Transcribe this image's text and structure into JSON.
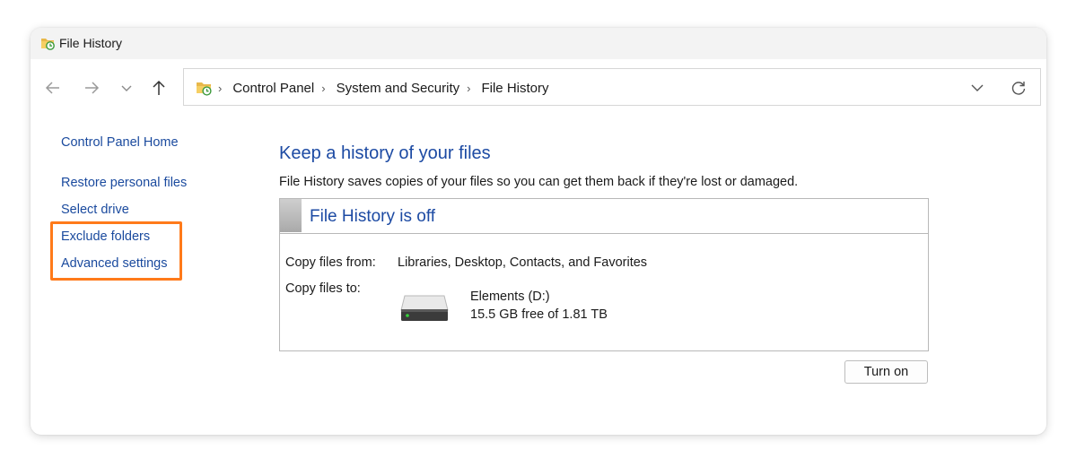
{
  "window": {
    "title": "File History"
  },
  "nav": {
    "back_icon": "arrow-left-icon",
    "forward_icon": "arrow-right-icon",
    "recent_icon": "chevron-down-icon",
    "up_icon": "arrow-up-icon"
  },
  "address": {
    "crumbs": [
      "Control Panel",
      "System and Security",
      "File History"
    ],
    "dropdown_icon": "chevron-down-icon",
    "refresh_icon": "refresh-icon"
  },
  "sidebar": {
    "items": [
      {
        "label": "Control Panel Home"
      },
      {
        "label": "Restore personal files"
      },
      {
        "label": "Select drive"
      },
      {
        "label": "Exclude folders"
      },
      {
        "label": "Advanced settings"
      }
    ],
    "highlight_color": "#ff7a1a"
  },
  "main": {
    "title": "Keep a history of your files",
    "description": "File History saves copies of your files so you can get them back if they're lost or damaged.",
    "status": {
      "title": "File History is off",
      "copy_from_label": "Copy files from:",
      "copy_from_value": "Libraries, Desktop, Contacts, and Favorites",
      "copy_to_label": "Copy files to:",
      "drive_name": "Elements (D:)",
      "drive_free": "15.5 GB free of 1.81 TB",
      "drive_icon": "hard-drive-icon"
    },
    "turn_on_label": "Turn on"
  },
  "colors": {
    "link": "#1a4a9e",
    "heading": "#1c4aa3",
    "highlight": "#ff7a1a"
  }
}
